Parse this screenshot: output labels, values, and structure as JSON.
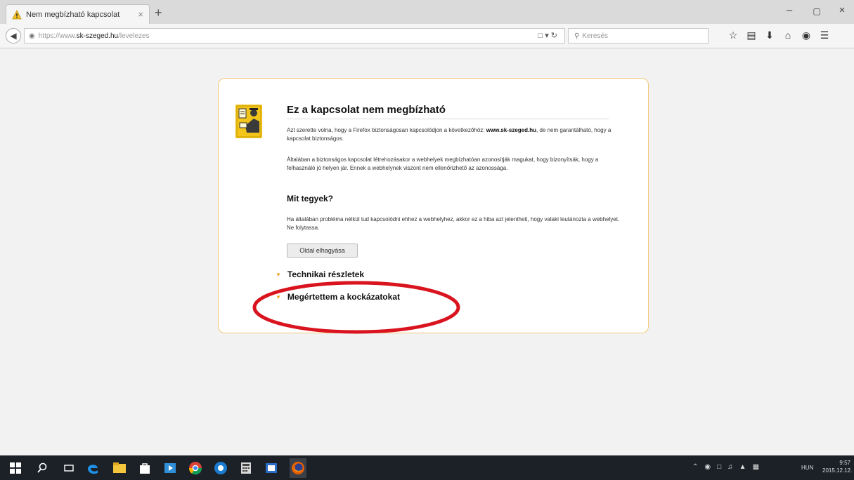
{
  "browser": {
    "tab_title": "Nem megbízható kapcsolat",
    "tab_close": "×",
    "new_tab": "+",
    "window_minimize": "–",
    "window_maximize": "▢",
    "window_close": "×",
    "url_prefix": "https://www.",
    "url_host": "sk-szeged.hu",
    "url_path": "/levelezes",
    "search_placeholder": "Keresés",
    "toolbar_icons": [
      "star-icon",
      "clipboard-icon",
      "download-icon",
      "home-icon",
      "chat-icon",
      "menu-icon"
    ]
  },
  "error_page": {
    "title": "Ez a kapcsolat nem megbízható",
    "p1_before": "Azt szerette volna, hogy a Firefox biztonságosan kapcsolódjon a következőhöz: ",
    "p1_host": "www.sk-szeged.hu",
    "p1_after": ", de nem garantálható, hogy a kapcsolat biztonságos.",
    "p2": "Általában a biztonságos kapcsolat létrehozásakor a webhelyek megbízhatóan azonosítják magukat, hogy bizonyítsák, hogy a felhasználó jó helyen jár. Ennek a webhelynek viszont nem ellenőrizhető az azonossága.",
    "what_to_do_title": "Mit tegyek?",
    "p3": "Ha általában probléma nélkül tud kapcsolódni ehhez a webhelyhez, akkor ez a hiba azt jelentheti, hogy valaki leutánozta a webhelyet. Ne folytassa.",
    "leave_button": "Oldal elhagyása",
    "technical_details": "Technikai részletek",
    "understand_risks": "Megértettem a kockázatokat"
  },
  "colors": {
    "card_border": "#f4c979",
    "bullet": "#f0a020",
    "annotation": "#d9141e",
    "taskbar": "#1c2128"
  },
  "taskbar": {
    "pinned_icons": [
      "windows-start-icon",
      "search-icon",
      "task-view-icon",
      "edge-icon",
      "file-explorer-icon",
      "store-icon",
      "media-icon",
      "chrome-icon",
      "app-icon",
      "calculator-icon",
      "photos-icon",
      "firefox-icon"
    ],
    "language": "HUN",
    "time": "9:57",
    "date": "2015.12.12."
  }
}
